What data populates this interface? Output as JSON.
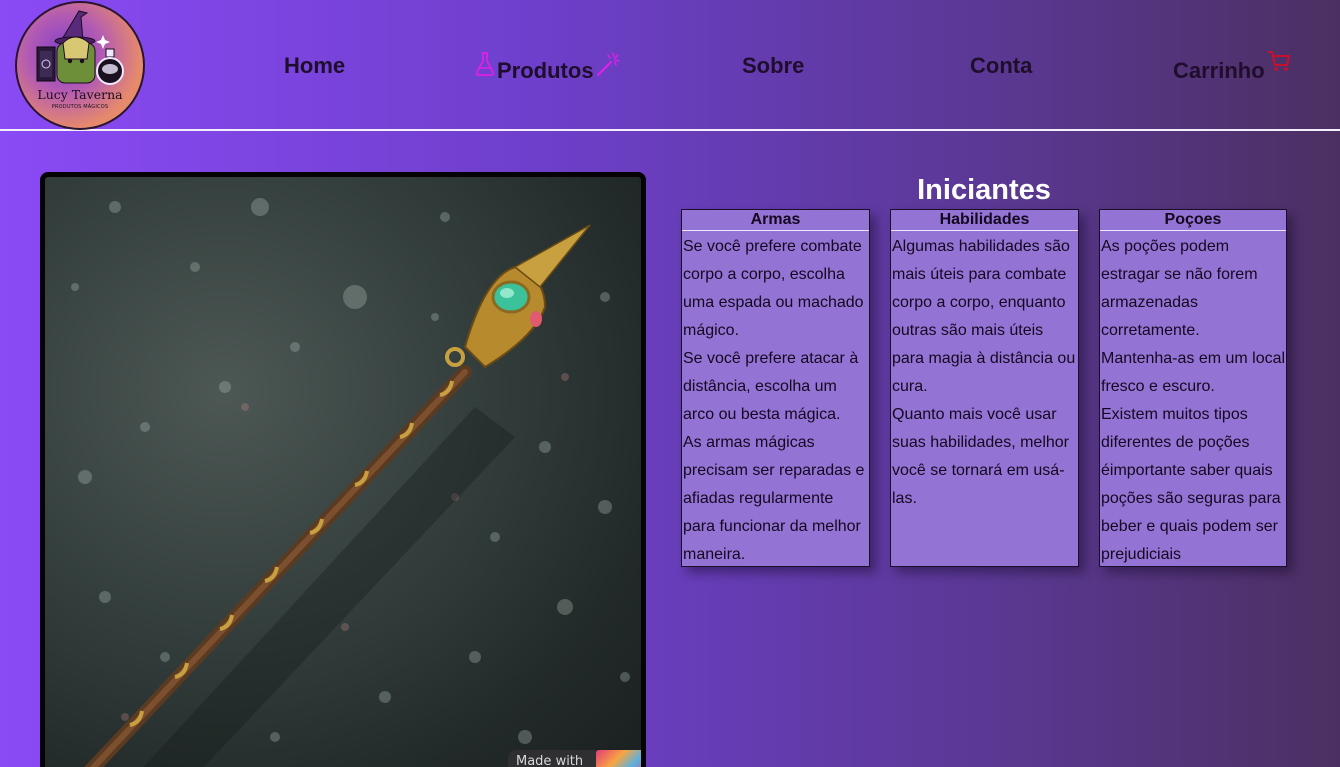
{
  "logo": {
    "title": "Lucy Taverna",
    "subtitle": "PRODUTOS MÁGICOS"
  },
  "nav": {
    "home": "Home",
    "produtos": "Produtos",
    "sobre": "Sobre",
    "conta": "Conta",
    "carrinho": "Carrinho"
  },
  "hero": {
    "watermark": "Made with"
  },
  "section": {
    "title": "Iniciantes"
  },
  "cards": [
    {
      "title": "Armas",
      "paragraphs": [
        "Se você prefere combate corpo a corpo, escolha uma espada ou machado mágico.",
        "Se você prefere atacar à distância, escolha um arco ou besta mágica.",
        "As armas mágicas precisam ser reparadas e afiadas regularmente para funcionar da melhor maneira."
      ]
    },
    {
      "title": "Habilidades",
      "paragraphs": [
        "Algumas habilidades são mais úteis para combate corpo a corpo, enquanto outras são mais úteis para magia à distância ou cura.",
        "Quanto mais você usar suas habilidades, melhor você se tornará em usá-las."
      ]
    },
    {
      "title": "Poçoes",
      "paragraphs": [
        "As poções podem estragar se não forem armazenadas corretamente.",
        "Mantenha-as em um local fresco e escuro.",
        "Existem muitos tipos diferentes de poções éimportante saber quais poções são seguras para beber e quais podem ser prejudiciais"
      ]
    }
  ],
  "colors": {
    "accent_icon": "#e01fe8",
    "cart_icon": "#c8102e",
    "nav_text": "#1e0e2c",
    "card_bg": "#9374d5"
  },
  "icons": {
    "produtos_left": "flask-icon",
    "produtos_right": "magic-wand-icon",
    "carrinho": "cart-icon"
  }
}
